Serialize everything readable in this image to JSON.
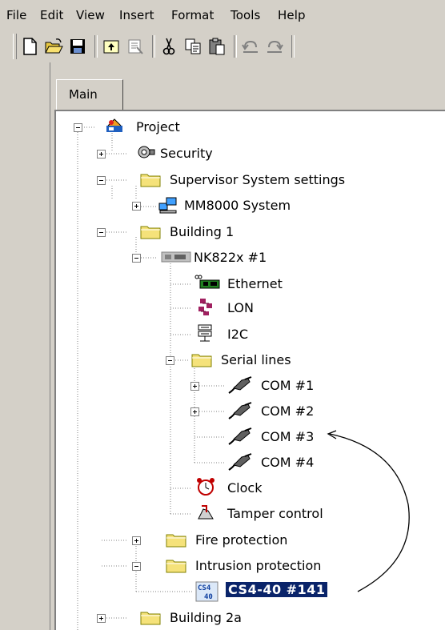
{
  "menubar": {
    "items": [
      {
        "label": "File"
      },
      {
        "label": "Edit"
      },
      {
        "label": "View"
      },
      {
        "label": "Insert"
      },
      {
        "label": "Format"
      },
      {
        "label": "Tools"
      },
      {
        "label": "Help"
      }
    ]
  },
  "toolbar": {
    "buttons": [
      {
        "icon": "new-document-icon"
      },
      {
        "icon": "open-folder-icon"
      },
      {
        "icon": "save-disk-icon"
      },
      {
        "icon": "insert-object-icon"
      },
      {
        "icon": "properties-icon"
      },
      {
        "icon": "cut-scissors-icon"
      },
      {
        "icon": "copy-icon"
      },
      {
        "icon": "paste-icon"
      },
      {
        "icon": "undo-icon"
      },
      {
        "icon": "redo-icon"
      }
    ]
  },
  "tabs": [
    {
      "label": "Main"
    }
  ],
  "tree": {
    "nodes": [
      {
        "label": "Project",
        "icon": "project-icon"
      },
      {
        "label": "Security",
        "icon": "security-icon"
      },
      {
        "label": "Supervisor System settings",
        "icon": "folder-icon"
      },
      {
        "label": "MM8000 System",
        "icon": "computer-icon"
      },
      {
        "label": "Building 1",
        "icon": "folder-icon"
      },
      {
        "label": "NK822x #1",
        "icon": "controller-icon"
      },
      {
        "label": "Ethernet",
        "icon": "ethernet-card-icon"
      },
      {
        "label": "LON",
        "icon": "lon-network-icon"
      },
      {
        "label": "I2C",
        "icon": "i2c-bus-icon"
      },
      {
        "label": "Serial lines",
        "icon": "folder-icon"
      },
      {
        "label": "COM #1",
        "icon": "serial-cable-icon"
      },
      {
        "label": "COM #2",
        "icon": "serial-cable-icon"
      },
      {
        "label": "COM #3",
        "icon": "serial-cable-icon"
      },
      {
        "label": "COM #4",
        "icon": "serial-cable-icon"
      },
      {
        "label": "Clock",
        "icon": "alarm-clock-icon"
      },
      {
        "label": "Tamper control",
        "icon": "tamper-hand-icon"
      },
      {
        "label": "Fire protection",
        "icon": "folder-icon"
      },
      {
        "label": "Intrusion protection",
        "icon": "folder-icon"
      },
      {
        "label": "CS4-40 #141",
        "icon": "cs4-40-module-icon",
        "badge_line1": "CS4",
        "badge_line2": "40",
        "selected": true
      },
      {
        "label": "Building 2a",
        "icon": "folder-icon"
      }
    ]
  },
  "colors": {
    "selection": "#0a246a",
    "background": "#d4d0c8",
    "folder": "#f5e27a"
  }
}
